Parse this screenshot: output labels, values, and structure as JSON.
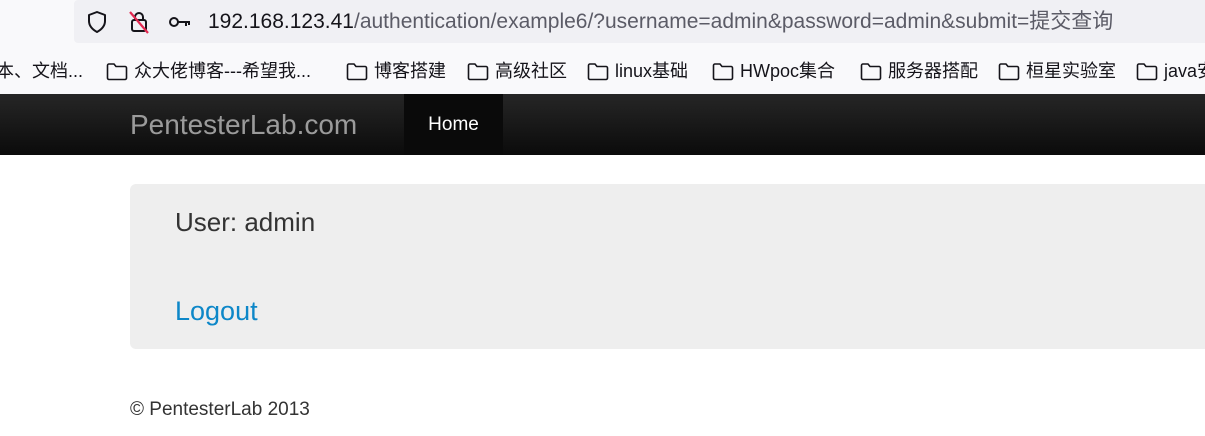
{
  "browser": {
    "url_host": "192.168.123.41",
    "url_rest": "/authentication/example6/?username=admin&password=admin&submit=提交查询",
    "icons": [
      "shield-icon",
      "page-permissions-icon",
      "key-icon"
    ]
  },
  "bookmarks": [
    "本、文档...",
    "众大佬博客---希望我...",
    "博客搭建",
    "高级社区",
    "linux基础",
    "HWpoc集合",
    "服务器搭配",
    "桓星实验室",
    "java安"
  ],
  "navbar": {
    "brand": "PentesterLab.com",
    "home": "Home"
  },
  "main": {
    "user_line": "User: admin",
    "logout": "Logout"
  },
  "footer": {
    "text": "© PentesterLab 2013"
  },
  "colors": {
    "link": "#0d87c8",
    "navbar": "#1b1b1b"
  }
}
